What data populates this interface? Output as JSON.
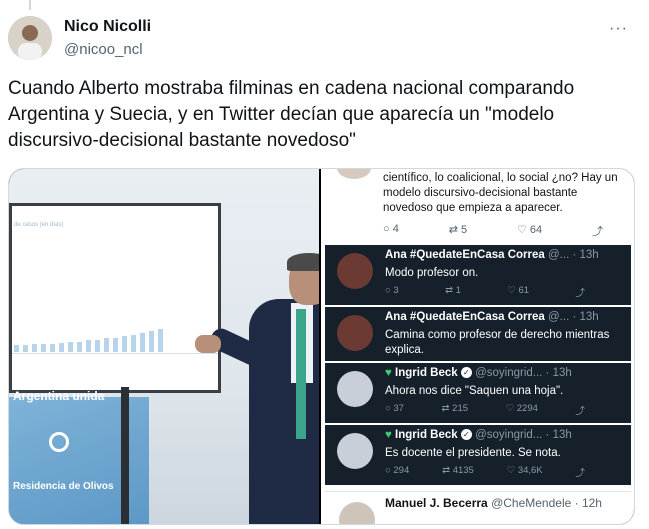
{
  "author": {
    "name": "Nico Nicolli",
    "handle": "@nicoo_ncl"
  },
  "more_icon": "more-horizontal-icon",
  "tweet": {
    "text": "Cuando Alberto mostraba filminas en cadena nacional comparando Argentina y Suecia, y en Twitter decían que aparecía un \"modelo discursivo-decisional bastante novedoso\""
  },
  "photo": {
    "screen_label": "de casos (en días)",
    "brand": "Argentina unida",
    "residence": "Residencia de Olivos",
    "bar_values": [
      0.25,
      0.28,
      0.3,
      0.3,
      0.32,
      0.35,
      0.38,
      0.4,
      0.45,
      0.48,
      0.52,
      0.55,
      0.6,
      0.66,
      0.72,
      0.8,
      0.9
    ]
  },
  "screenshot": {
    "top_tweet": {
      "text": "científico, lo coalicional, lo social ¿no? Hay un modelo discursivo-decisional bastante novedoso que empieza a aparecer.",
      "replies": "4",
      "retweets": "5",
      "likes": "64"
    },
    "replies": [
      {
        "name": "Ana #QuedateEnCasa Correa",
        "handle": "@... · 13h",
        "text": "Modo profesor on.",
        "replies": "3",
        "retweets": "1",
        "likes": "61"
      },
      {
        "name": "Ana #QuedateEnCasa Correa",
        "handle": "@... · 13h",
        "text": "Camina como profesor de derecho mientras explica.",
        "replies": "",
        "retweets": "",
        "likes": ""
      },
      {
        "name": "Ingrid Beck",
        "handle": "@soyingrid... · 13h",
        "text": "Ahora nos dice \"Saquen una hoja\".",
        "replies": "37",
        "retweets": "215",
        "likes": "2294"
      },
      {
        "name": "Ingrid Beck",
        "handle": "@soyingrid... · 13h",
        "text": "Es docente el presidente. Se nota.",
        "replies": "294",
        "retweets": "4135",
        "likes": "34,6K"
      }
    ],
    "last": {
      "name": "Manuel J. Becerra",
      "handle": "@CheMendele · 12h"
    }
  }
}
